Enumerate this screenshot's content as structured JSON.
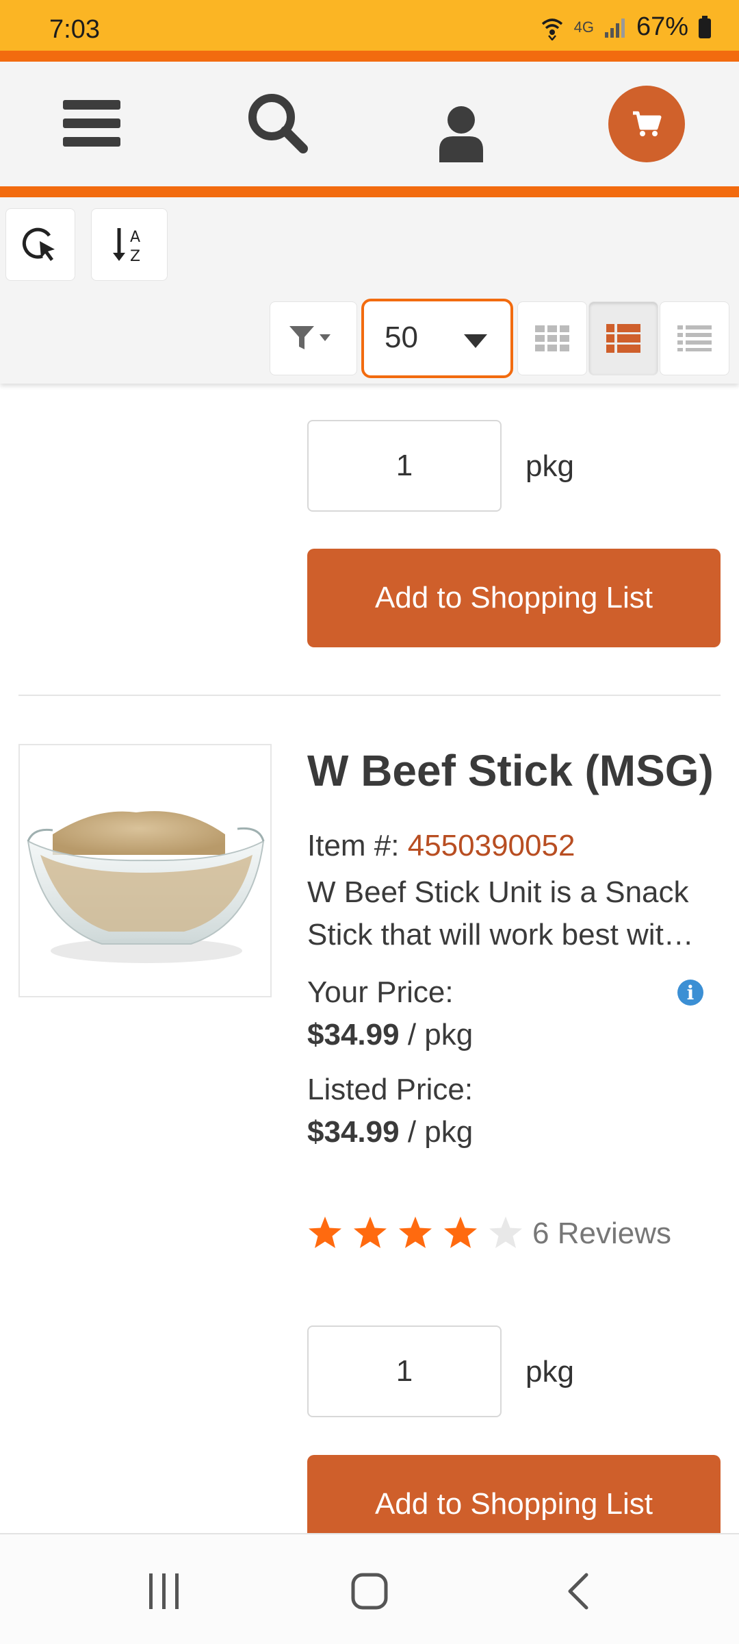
{
  "status_bar": {
    "time": "7:03",
    "network": "4G",
    "battery": "67%"
  },
  "header": {
    "icons": [
      "menu-icon",
      "search-icon",
      "user-icon",
      "cart-icon"
    ]
  },
  "toolbar": {
    "icons": [
      "refresh-cursor-icon",
      "sort-az-icon",
      "filter-icon",
      "grid-view-icon",
      "list-detail-view-icon",
      "list-view-icon"
    ],
    "per_page": "50"
  },
  "previous_product": {
    "quantity": "1",
    "unit": "pkg",
    "add_button": "Add to Shopping List"
  },
  "product": {
    "title": "W Beef Stick (MSG)",
    "item_label": "Item #:",
    "item_number": "4550390052",
    "description_line1": "W Beef Stick Unit is a Snack",
    "description_line2": "Stick that will work best wit…",
    "your_price_label": "Your Price:",
    "your_price": "$34.99",
    "your_price_unit": "/ pkg",
    "listed_price_label": "Listed Price:",
    "listed_price": "$34.99",
    "listed_price_unit": "/ pkg",
    "rating": 4,
    "rating_max": 5,
    "reviews": "6 Reviews",
    "quantity": "1",
    "unit": "pkg",
    "add_button": "Add to Shopping List"
  },
  "colors": {
    "status_bar": "#fbb524",
    "accent_orange": "#f26b0f",
    "button": "#cf5f2b",
    "star": "#ff6a0f",
    "item_number": "#b84e22"
  },
  "bottom_nav": {
    "icons": [
      "recent-apps-icon",
      "home-icon",
      "back-icon"
    ]
  }
}
